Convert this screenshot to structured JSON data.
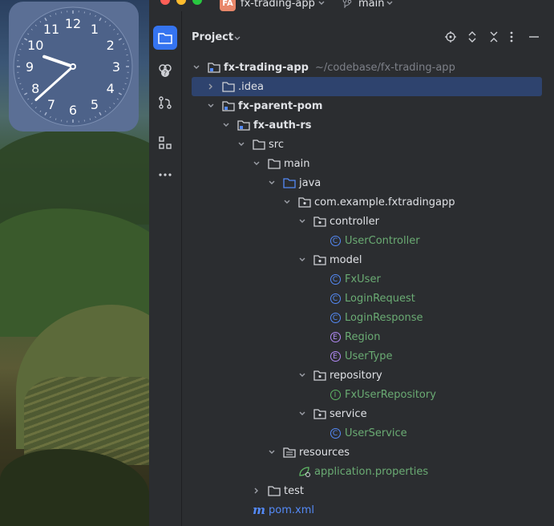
{
  "window": {
    "project_badge": "FA",
    "project_name": "fx-trading-app",
    "branch": "main"
  },
  "clock": {
    "hour": 9,
    "minute": 38,
    "numerals": [
      "12",
      "1",
      "2",
      "3",
      "4",
      "5",
      "6",
      "7",
      "8",
      "9",
      "10",
      "11"
    ]
  },
  "toolwindow": {
    "title": "Project"
  },
  "tree": {
    "root": {
      "label": "fx-trading-app",
      "path": "~/codebase/fx-trading-app"
    },
    "idea": ".idea",
    "parent_pom": "fx-parent-pom",
    "auth": "fx-auth-rs",
    "src": "src",
    "main": "main",
    "java": "java",
    "pkg": "com.example.fxtradingapp",
    "controller": "controller",
    "user_controller": "UserController",
    "model": "model",
    "fx_user": "FxUser",
    "login_request": "LoginRequest",
    "login_response": "LoginResponse",
    "region": "Region",
    "user_type": "UserType",
    "repository": "repository",
    "fx_user_repository": "FxUserRepository",
    "service": "service",
    "user_service": "UserService",
    "resources": "resources",
    "app_props": "application.properties",
    "test": "test",
    "pom": "pom.xml"
  },
  "colors": {
    "accent": "#3574f0",
    "selection": "#2e436e",
    "class": "#548af7",
    "enum": "#b189f5",
    "green_text": "#6aab73"
  }
}
